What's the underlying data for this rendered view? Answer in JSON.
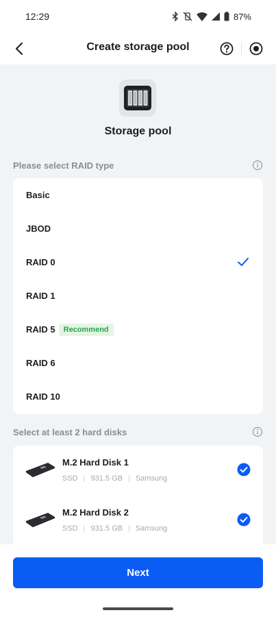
{
  "status_bar": {
    "time": "12:29",
    "battery": "87%",
    "icons": [
      "bluetooth-icon",
      "vibrate-off-icon",
      "wifi-icon",
      "signal-icon",
      "battery-icon"
    ]
  },
  "header": {
    "title": "Create storage pool",
    "back_icon": "back-arrow-icon",
    "help_icon": "help-icon",
    "record_icon": "record-icon"
  },
  "hero": {
    "title": "Storage pool",
    "icon": "storage-pool-icon"
  },
  "raid_section": {
    "label": "Please select RAID type",
    "items": [
      {
        "label": "Basic",
        "selected": false,
        "badge": ""
      },
      {
        "label": "JBOD",
        "selected": false,
        "badge": ""
      },
      {
        "label": "RAID 0",
        "selected": true,
        "badge": ""
      },
      {
        "label": "RAID 1",
        "selected": false,
        "badge": ""
      },
      {
        "label": "RAID 5",
        "selected": false,
        "badge": "Recommend"
      },
      {
        "label": "RAID 6",
        "selected": false,
        "badge": ""
      },
      {
        "label": "RAID 10",
        "selected": false,
        "badge": ""
      }
    ]
  },
  "disk_section": {
    "label": "Select at least 2 hard disks",
    "disks": [
      {
        "name": "M.2 Hard Disk 1",
        "type": "SSD",
        "size": "931.5 GB",
        "brand": "Samsung",
        "checked": true
      },
      {
        "name": "M.2 Hard Disk 2",
        "type": "SSD",
        "size": "931.5 GB",
        "brand": "Samsung",
        "checked": true
      }
    ]
  },
  "actions": {
    "next_label": "Next"
  },
  "colors": {
    "accent": "#0a5cf5",
    "badge_bg": "#e4f5e6",
    "badge_text": "#2aa44a",
    "background": "#f2f3f5"
  }
}
